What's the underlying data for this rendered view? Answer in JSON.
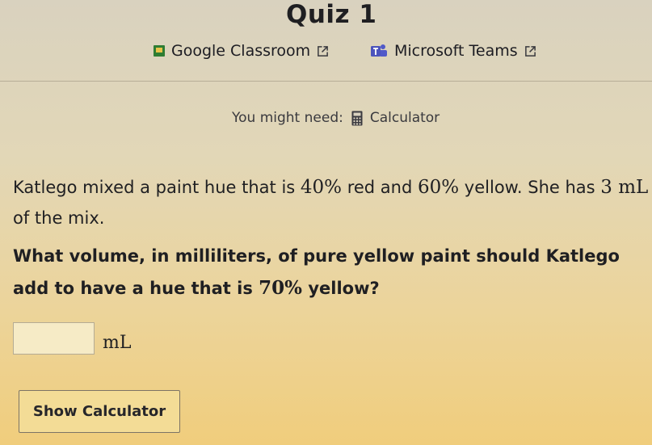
{
  "quiz": {
    "title": "Quiz 1"
  },
  "share": {
    "classroom_label": "Google Classroom",
    "teams_label": "Microsoft Teams"
  },
  "tools": {
    "need_label": "You might need:",
    "calculator_label": "Calculator"
  },
  "question": {
    "part1": "Katlego mixed a paint hue that is ",
    "red_percent": "40%",
    "part2": " red and ",
    "yellow_percent": "60%",
    "part3": " yellow. She has ",
    "volume": "3 mL",
    "part4": " of the mix.",
    "prompt_part1": "What volume, in milliliters, of pure yellow paint should Katlego add to have a hue that is ",
    "target_percent": "70%",
    "prompt_part2": " yellow?"
  },
  "answer": {
    "value": "",
    "unit": "mL"
  },
  "buttons": {
    "show_calculator": "Show Calculator"
  },
  "colors": {
    "classroom_green": "#2e7d32",
    "teams_purple": "#5059c9"
  }
}
